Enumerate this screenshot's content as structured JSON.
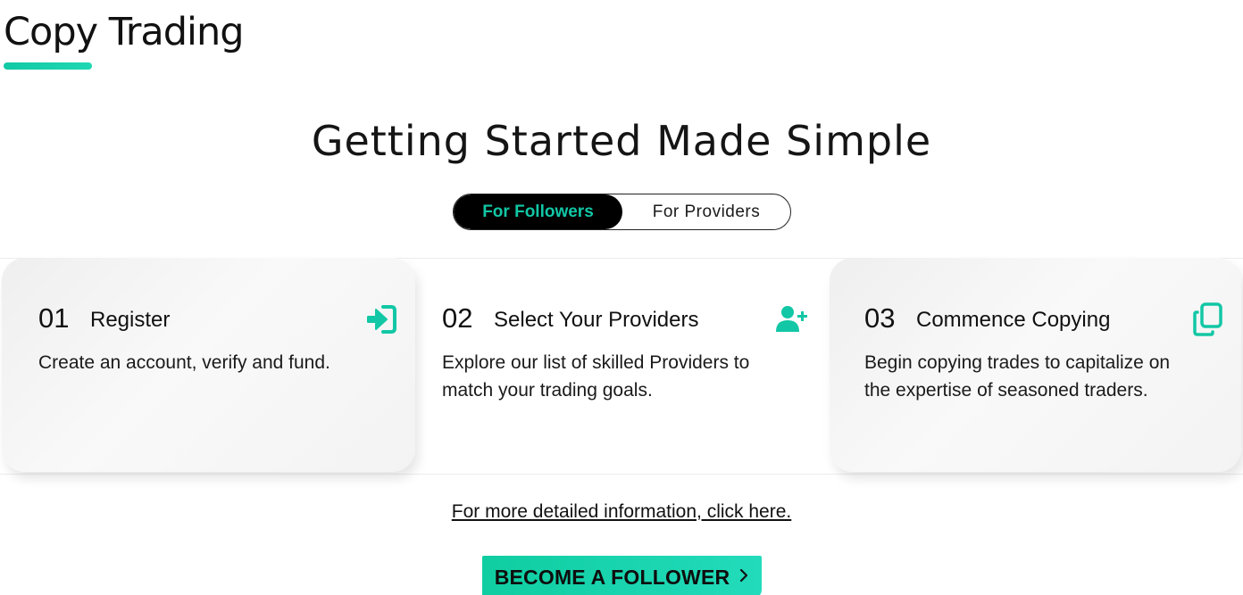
{
  "header": {
    "title": "Copy Trading"
  },
  "section": {
    "heading": "Getting Started Made Simple"
  },
  "toggle": {
    "followers_label": "For Followers",
    "providers_label": "For Providers",
    "active": "followers"
  },
  "steps": [
    {
      "number": "01",
      "title": "Register",
      "description": "Create an account, verify and fund.",
      "icon": "sign-in-icon"
    },
    {
      "number": "02",
      "title": "Select Your Providers",
      "description": "Explore our list of skilled Providers to match your trading goals.",
      "icon": "user-plus-icon"
    },
    {
      "number": "03",
      "title": "Commence Copying",
      "description": "Begin copying trades to capitalize on the expertise of seasoned traders.",
      "icon": "copy-icon"
    }
  ],
  "more_info": {
    "link_text": "For more detailed information, click here."
  },
  "cta": {
    "label": "BECOME A FOLLOWER",
    "icon": "chevron-right-icon"
  },
  "colors": {
    "accent": "#12c7a5",
    "cta_start": "#10cda1",
    "cta_end": "#22dbbb",
    "toggle_active_bg": "#000000"
  }
}
